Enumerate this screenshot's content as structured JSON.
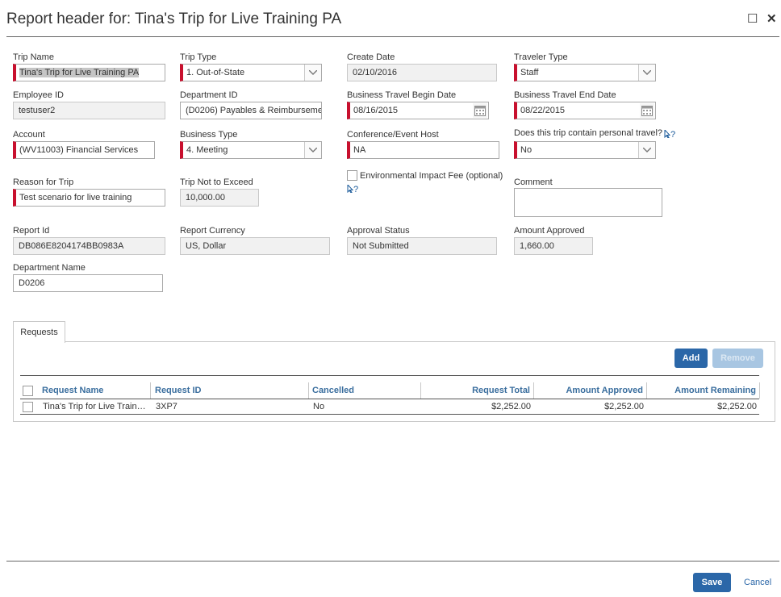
{
  "dialog": {
    "title": "Report header for: Tina's Trip for Live Training PA",
    "maximize_glyph": "☐",
    "close_glyph": "✕"
  },
  "form": {
    "trip_name": {
      "label": "Trip Name",
      "value": "Tina's Trip for Live Training PA"
    },
    "trip_type": {
      "label": "Trip Type",
      "value": "1. Out-of-State"
    },
    "create_date": {
      "label": "Create Date",
      "value": "02/10/2016"
    },
    "traveler_type": {
      "label": "Traveler Type",
      "value": "Staff"
    },
    "employee_id": {
      "label": "Employee ID",
      "value": "testuser2"
    },
    "department_id": {
      "label": "Department ID",
      "value": "(D0206) Payables & Reimburseme"
    },
    "begin_date": {
      "label": "Business Travel Begin Date",
      "value": "08/16/2015"
    },
    "end_date": {
      "label": "Business Travel End Date",
      "value": "08/22/2015"
    },
    "account": {
      "label": "Account",
      "value": "(WV11003) Financial Services"
    },
    "business_type": {
      "label": "Business Type",
      "value": "4. Meeting"
    },
    "conference_host": {
      "label": "Conference/Event Host",
      "value": "NA"
    },
    "personal_travel": {
      "label": "Does this trip contain personal travel?",
      "value": "No"
    },
    "reason": {
      "label": "Reason for Trip",
      "value": "Test scenario for live training"
    },
    "not_to_exceed": {
      "label": "Trip Not to Exceed",
      "value": "10,000.00"
    },
    "environmental_fee": {
      "label": "Environmental Impact Fee (optional)",
      "checked": false
    },
    "comment": {
      "label": "Comment",
      "value": ""
    },
    "report_id": {
      "label": "Report Id",
      "value": "DB086E8204174BB0983A"
    },
    "report_currency": {
      "label": "Report Currency",
      "value": "US, Dollar"
    },
    "approval_status": {
      "label": "Approval Status",
      "value": "Not Submitted"
    },
    "amount_approved": {
      "label": "Amount Approved",
      "value": "1,660.00"
    },
    "department_name": {
      "label": "Department Name",
      "value": "D0206"
    },
    "help_glyph": "?"
  },
  "requests": {
    "tab_label": "Requests",
    "add_label": "Add",
    "remove_label": "Remove",
    "columns": [
      "Request Name",
      "Request ID",
      "Cancelled",
      "Request Total",
      "Amount Approved",
      "Amount Remaining"
    ],
    "rows": [
      {
        "name": "Tina's Trip for Live Train…",
        "id": "3XP7",
        "cancelled": "No",
        "total": "$2,252.00",
        "approved": "$2,252.00",
        "remaining": "$2,252.00"
      }
    ]
  },
  "footer": {
    "save_label": "Save",
    "cancel_label": "Cancel"
  },
  "colors": {
    "accent": "#2b67a8",
    "required": "#c8102e",
    "header_text": "#3a6e9e"
  }
}
